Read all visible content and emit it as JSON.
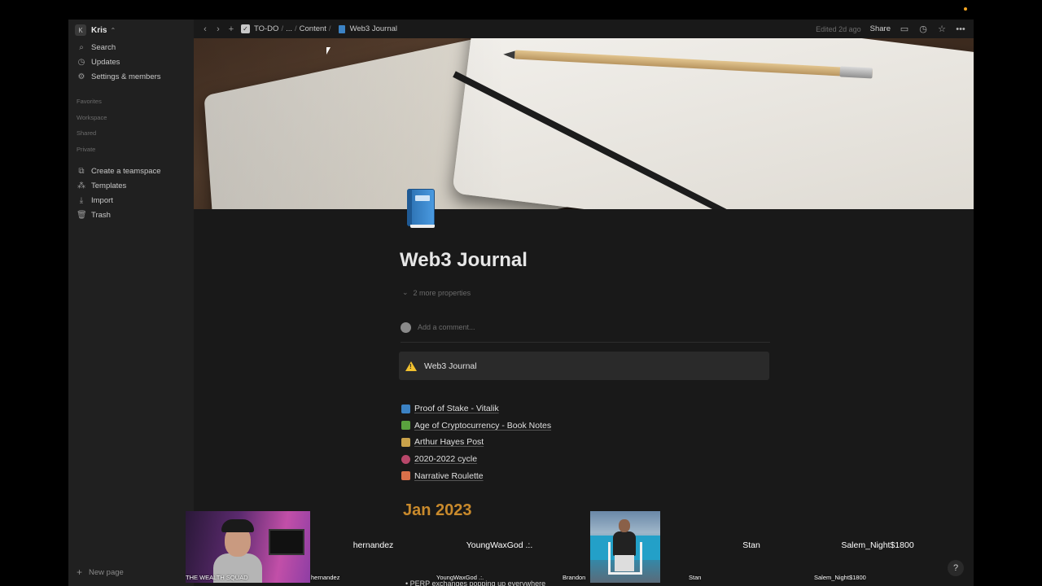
{
  "workspace": {
    "badge": "K",
    "name": "Kris",
    "caret": "⌃"
  },
  "sidebar": {
    "nav": [
      {
        "icon": "search-icon",
        "glyph": "⌕",
        "label": "Search"
      },
      {
        "icon": "clock-icon",
        "glyph": "◷",
        "label": "Updates"
      },
      {
        "icon": "gear-icon",
        "glyph": "⚙",
        "label": "Settings & members"
      }
    ],
    "sections": [
      "Favorites",
      "Workspace",
      "Shared",
      "Private"
    ],
    "actions": [
      {
        "icon": "teamspace-icon",
        "glyph": "⧉",
        "label": "Create a teamspace"
      },
      {
        "icon": "templates-icon",
        "glyph": "⁂",
        "label": "Templates"
      },
      {
        "icon": "import-icon",
        "glyph": "⤓",
        "label": "Import"
      },
      {
        "icon": "trash-icon",
        "glyph": "🗑",
        "label": "Trash"
      }
    ],
    "new_page": "New page"
  },
  "topbar": {
    "back": "‹",
    "forward": "›",
    "add": "+",
    "breadcrumbs": [
      "TO-DO",
      "...",
      "Content",
      "Web3 Journal"
    ],
    "edited": "Edited 2d ago",
    "share": "Share"
  },
  "page": {
    "title": "Web3 Journal",
    "properties_toggle": "2 more properties",
    "comment_placeholder": "Add a comment...",
    "callout": "Web3 Journal",
    "links": [
      {
        "color": "#3b82c4",
        "label": "Proof of Stake - Vitalik"
      },
      {
        "color": "#5aa33e",
        "label": "Age of Cryptocurrency - Book Notes"
      },
      {
        "color": "#c9a24a",
        "label": "Arthur Hayes Post"
      },
      {
        "color": "#b8476a",
        "label": "2020-2022 cycle"
      },
      {
        "color": "#d9704a",
        "label": "Narrative Roulette"
      }
    ],
    "heading_partial": "Jan 2023",
    "bullet_partial": "PERP exchanges popping up everywhere"
  },
  "webcams": [
    {
      "label": "THE WEALTH SQUAD",
      "name": ""
    },
    {
      "label": "hernandez",
      "name": "hernandez"
    },
    {
      "label": "YoungWaxGod .:.",
      "name": "YoungWaxGod .:."
    },
    {
      "label": "Brandon",
      "name": ""
    },
    {
      "label": "Stan",
      "name": "Stan"
    },
    {
      "label": "Salem_Night$1800",
      "name": "Salem_Night$1800"
    }
  ],
  "help": "?"
}
